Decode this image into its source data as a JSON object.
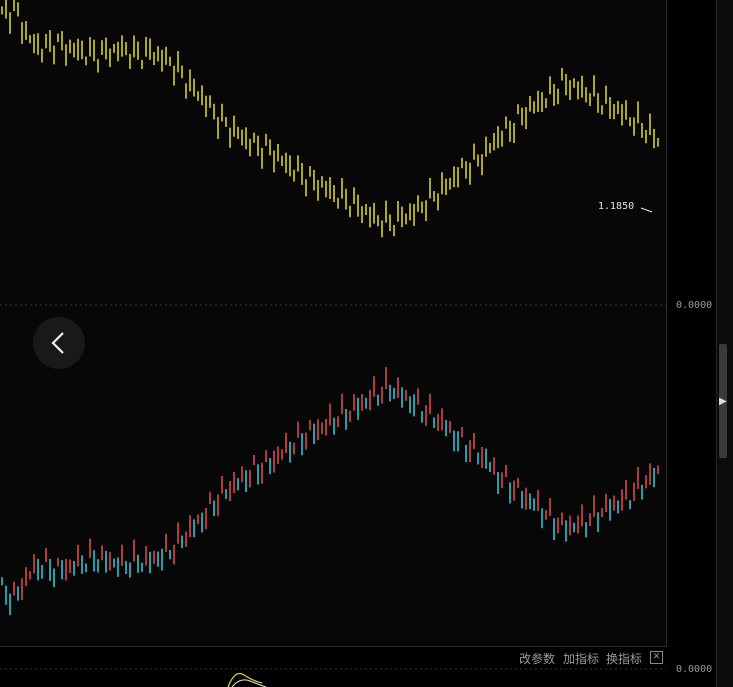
{
  "chart_data": {
    "type": "candlestick",
    "series": [
      {
        "color": "#d9d122",
        "trend": "falling",
        "values": [
          95,
          97,
          87,
          84,
          86,
          84,
          83,
          82,
          83,
          84,
          82,
          83,
          81,
          78,
          72,
          68,
          62,
          58,
          55,
          52,
          51,
          47,
          44,
          41,
          39,
          36,
          34,
          31,
          28,
          27,
          29,
          31,
          35,
          38,
          43,
          46,
          49,
          55,
          58,
          63,
          66,
          69,
          73,
          71,
          69,
          66,
          64,
          61,
          58,
          54
        ]
      },
      {
        "color": "#2ec4d6",
        "up_color": "#d84a4a",
        "trend": "rising",
        "values": [
          -94,
          -96,
          -88,
          -85,
          -87,
          -86,
          -84,
          -83,
          -84,
          -85,
          -84,
          -84,
          -82,
          -79,
          -74,
          -70,
          -64,
          -60,
          -57,
          -54,
          -52,
          -48,
          -45,
          -42,
          -40,
          -37,
          -35,
          -32,
          -29,
          -27,
          -30,
          -33,
          -36,
          -39,
          -44,
          -47,
          -50,
          -56,
          -59,
          -63,
          -66,
          -70,
          -73,
          -72,
          -70,
          -67,
          -65,
          -62,
          -58,
          -55
        ]
      }
    ],
    "last_value_label": "1.1850",
    "zero_axis_label": "0.0000",
    "sub_axis_label": "0.0000"
  },
  "toolbar": {
    "modify_params": "改参数",
    "add_indicator": "加指标",
    "switch_indicator": "换指标",
    "close_symbol": "✕"
  },
  "icons": {
    "back": "chevron-left-icon",
    "collapse": "caret-right-icon"
  }
}
